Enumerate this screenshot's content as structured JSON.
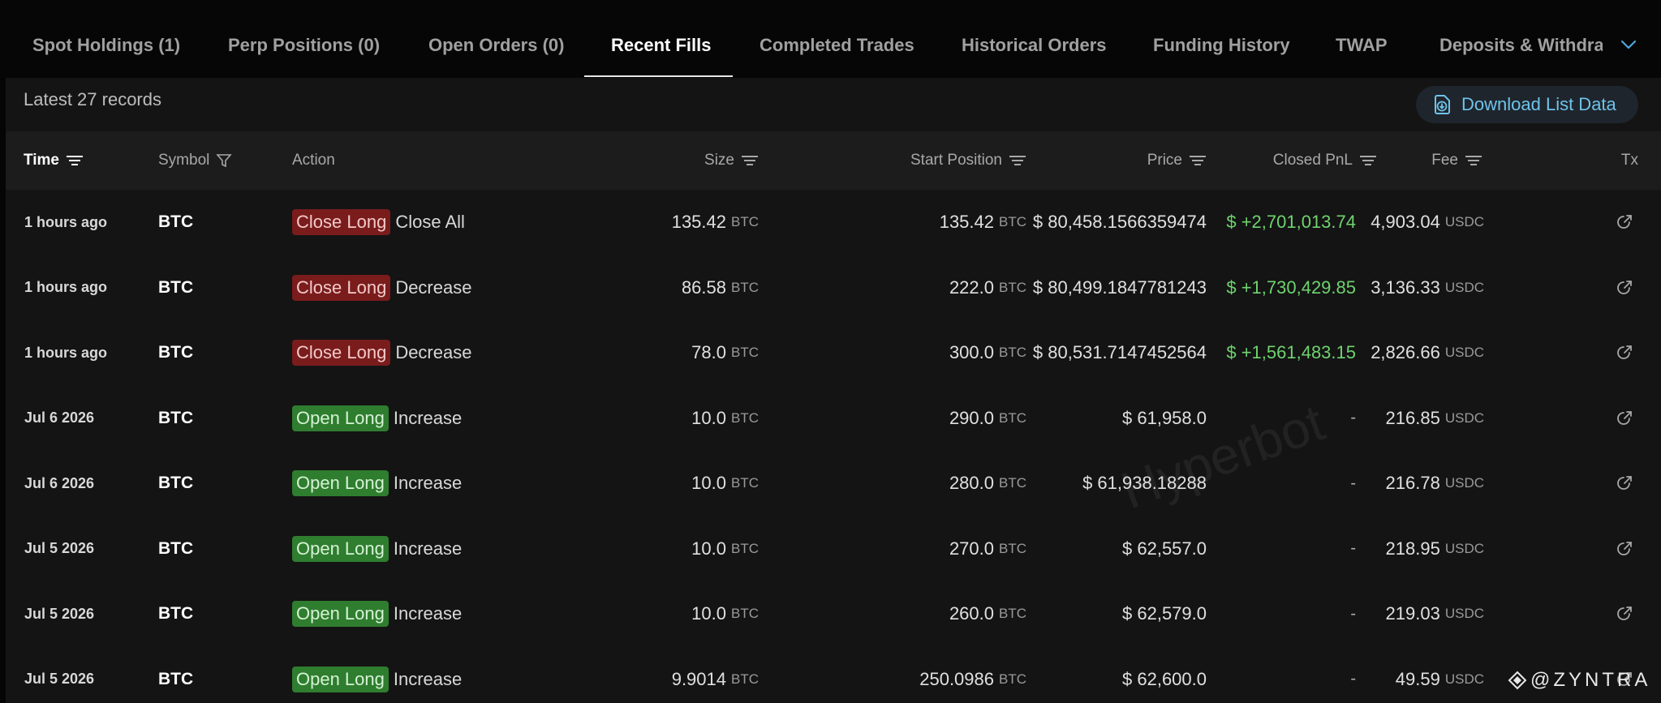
{
  "tabs": [
    {
      "label": "Spot Holdings (1)",
      "active": false
    },
    {
      "label": "Perp Positions (0)",
      "active": false
    },
    {
      "label": "Open Orders (0)",
      "active": false
    },
    {
      "label": "Recent Fills",
      "active": true
    },
    {
      "label": "Completed Trades",
      "active": false
    },
    {
      "label": "Historical Orders",
      "active": false
    },
    {
      "label": "Funding History",
      "active": false
    },
    {
      "label": "TWAP",
      "active": false
    },
    {
      "label": "Deposits & Withdrawals",
      "active": false
    }
  ],
  "records_label": "Latest 27 records",
  "download_label": "Download List Data",
  "columns": {
    "time": "Time",
    "symbol": "Symbol",
    "action": "Action",
    "size": "Size",
    "start_position": "Start Position",
    "price": "Price",
    "closed_pnl": "Closed PnL",
    "fee": "Fee",
    "tx": "Tx"
  },
  "rows": [
    {
      "time": "1 hours ago",
      "symbol": "BTC",
      "action_badge": "Close Long",
      "action_type": "close",
      "action_detail": "Close All",
      "size": "135.42",
      "size_unit": "BTC",
      "start_position": "135.42",
      "start_unit": "BTC",
      "price": "$ 80,458.1566359474",
      "closed_pnl": "$ +2,701,013.74",
      "fee": "4,903.04",
      "fee_unit": "USDC"
    },
    {
      "time": "1 hours ago",
      "symbol": "BTC",
      "action_badge": "Close Long",
      "action_type": "close",
      "action_detail": "Decrease",
      "size": "86.58",
      "size_unit": "BTC",
      "start_position": "222.0",
      "start_unit": "BTC",
      "price": "$ 80,499.1847781243",
      "closed_pnl": "$ +1,730,429.85",
      "fee": "3,136.33",
      "fee_unit": "USDC"
    },
    {
      "time": "1 hours ago",
      "symbol": "BTC",
      "action_badge": "Close Long",
      "action_type": "close",
      "action_detail": "Decrease",
      "size": "78.0",
      "size_unit": "BTC",
      "start_position": "300.0",
      "start_unit": "BTC",
      "price": "$ 80,531.7147452564",
      "closed_pnl": "$ +1,561,483.15",
      "fee": "2,826.66",
      "fee_unit": "USDC"
    },
    {
      "time": "Jul 6 2026",
      "symbol": "BTC",
      "action_badge": "Open Long",
      "action_type": "open",
      "action_detail": "Increase",
      "size": "10.0",
      "size_unit": "BTC",
      "start_position": "290.0",
      "start_unit": "BTC",
      "price": "$ 61,958.0",
      "closed_pnl": "-",
      "fee": "216.85",
      "fee_unit": "USDC"
    },
    {
      "time": "Jul 6 2026",
      "symbol": "BTC",
      "action_badge": "Open Long",
      "action_type": "open",
      "action_detail": "Increase",
      "size": "10.0",
      "size_unit": "BTC",
      "start_position": "280.0",
      "start_unit": "BTC",
      "price": "$ 61,938.18288",
      "closed_pnl": "-",
      "fee": "216.78",
      "fee_unit": "USDC"
    },
    {
      "time": "Jul 5 2026",
      "symbol": "BTC",
      "action_badge": "Open Long",
      "action_type": "open",
      "action_detail": "Increase",
      "size": "10.0",
      "size_unit": "BTC",
      "start_position": "270.0",
      "start_unit": "BTC",
      "price": "$ 62,557.0",
      "closed_pnl": "-",
      "fee": "218.95",
      "fee_unit": "USDC"
    },
    {
      "time": "Jul 5 2026",
      "symbol": "BTC",
      "action_badge": "Open Long",
      "action_type": "open",
      "action_detail": "Increase",
      "size": "10.0",
      "size_unit": "BTC",
      "start_position": "260.0",
      "start_unit": "BTC",
      "price": "$ 62,579.0",
      "closed_pnl": "-",
      "fee": "219.03",
      "fee_unit": "USDC"
    },
    {
      "time": "Jul 5 2026",
      "symbol": "BTC",
      "action_badge": "Open Long",
      "action_type": "open",
      "action_detail": "Increase",
      "size": "9.9014",
      "size_unit": "BTC",
      "start_position": "250.0986",
      "start_unit": "BTC",
      "price": "$ 62,600.0",
      "closed_pnl": "-",
      "fee": "49.59",
      "fee_unit": "USDC"
    }
  ],
  "watermark": "Hyperbot",
  "handle": "@ZYNTRA",
  "colors": {
    "accent": "#6ec3ea",
    "close_badge": "#7a1c1c",
    "open_badge": "#2f7d2f",
    "pnl_positive": "#6fd36f"
  }
}
